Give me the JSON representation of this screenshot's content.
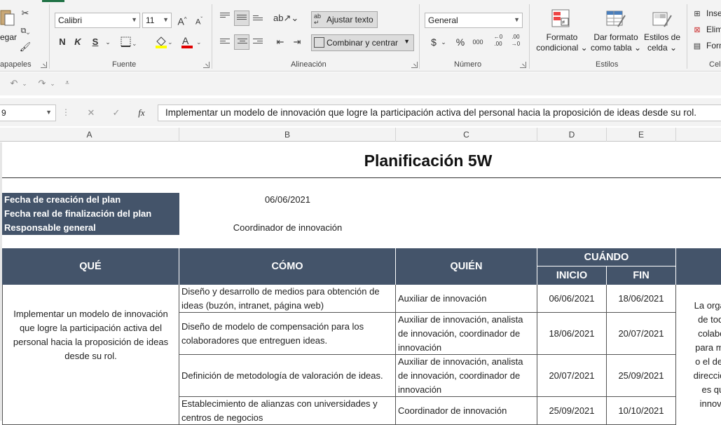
{
  "ribbon": {
    "clipboard": {
      "paste_label": "egar",
      "group_label": "apapeles"
    },
    "font": {
      "name": "Calibri",
      "size": "11",
      "bold": "N",
      "italic": "K",
      "underline": "S",
      "group_label": "Fuente"
    },
    "alignment": {
      "wrap_text": "Ajustar texto",
      "merge_center": "Combinar y centrar",
      "group_label": "Alineación"
    },
    "number": {
      "format": "General",
      "currency": "$",
      "percent": "%",
      "thousands": "000",
      "group_label": "Número"
    },
    "styles": {
      "conditional_format": [
        "Formato",
        "condicional"
      ],
      "format_as_table": [
        "Dar formato",
        "como tabla"
      ],
      "cell_styles": [
        "Estilos de",
        "celda"
      ],
      "group_label": "Estilos"
    },
    "cells": {
      "insert": "Inse",
      "delete": "Elim",
      "format": "Form",
      "group_label": "Cel"
    }
  },
  "formula_bar": {
    "name_box": "9",
    "fx": "fx",
    "content": "Implementar un modelo de innovación que logre la participación activa del personal hacia la proposición de ideas desde su rol."
  },
  "columns": [
    "A",
    "B",
    "C",
    "D",
    "E"
  ],
  "sheet": {
    "title": "Planificación 5W",
    "meta": [
      {
        "label": "Fecha de creación del plan",
        "value": "06/06/2021"
      },
      {
        "label": "Fecha real de finalización del plan",
        "value": ""
      },
      {
        "label": "Responsable general",
        "value": "Coordinador de innovación"
      }
    ],
    "headers": {
      "que": "QUÉ",
      "como": "CÓMO",
      "quien": "QUIÉN",
      "cuando": "CUÁNDO",
      "inicio": "INICIO",
      "fin": "FIN"
    },
    "que_text": "Implementar un modelo de innovación que logre la participación activa del personal hacia la proposición de ideas desde su rol.",
    "por_que_lines": [
      "La organiz",
      "de todos",
      "colabora",
      "para mejo",
      "o el de otr",
      "dirección n",
      "es que",
      "innovac"
    ],
    "rows": [
      {
        "como": "Diseño y desarrollo de medios para obtención de ideas (buzón, intranet, página web)",
        "quien": "Auxiliar de innovación",
        "inicio": "06/06/2021",
        "fin": "18/06/2021"
      },
      {
        "como": "Diseño de modelo de compensación para los colaboradores que entreguen ideas.",
        "quien": "Auxiliar de innovación, analista de innovación, coordinador de innovación",
        "inicio": "18/06/2021",
        "fin": "20/07/2021"
      },
      {
        "como": "Definición de  metodología de valoración de ideas.",
        "quien": "Auxiliar de innovación, analista de innovación, coordinador de innovación",
        "inicio": "20/07/2021",
        "fin": "25/09/2021"
      },
      {
        "como": "Establecimiento de alianzas con universidades y centros de negocios",
        "quien": "Coordinador de innovación",
        "inicio": "25/09/2021",
        "fin": "10/10/2021"
      }
    ]
  }
}
